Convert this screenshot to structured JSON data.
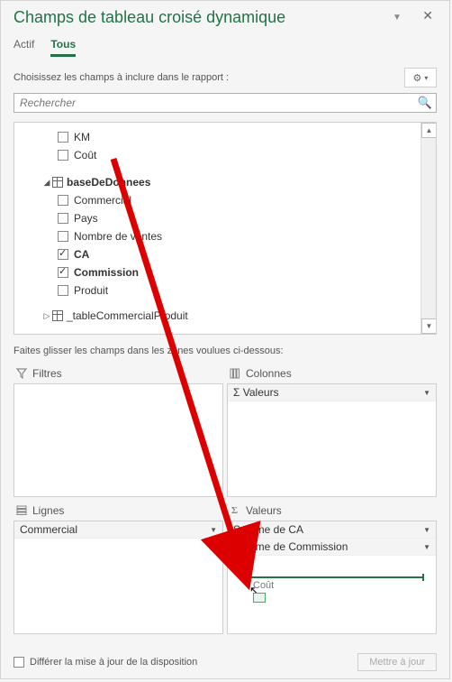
{
  "title": "Champs de tableau croisé dynamique",
  "tabs": {
    "actif": "Actif",
    "tous": "Tous"
  },
  "chooseText": "Choisissez les champs à inclure dans le rapport :",
  "search": {
    "placeholder": "Rechercher"
  },
  "tree": {
    "loose": [
      {
        "label": "KM",
        "checked": false
      },
      {
        "label": "Coût",
        "checked": false
      }
    ],
    "baseDeDonnees": {
      "name": "baseDeDonnees",
      "fields": [
        {
          "label": "Commercial",
          "checked": false,
          "bold": false
        },
        {
          "label": "Pays",
          "checked": false,
          "bold": false
        },
        {
          "label": "Nombre de ventes",
          "checked": false,
          "bold": false
        },
        {
          "label": "CA",
          "checked": true,
          "bold": true
        },
        {
          "label": "Commission",
          "checked": true,
          "bold": true
        },
        {
          "label": "Produit",
          "checked": false,
          "bold": false
        }
      ]
    },
    "tableCommercialProduit": {
      "name": "_tableCommercialProduit"
    }
  },
  "dragHint": "Faites glisser les champs dans les zones voulues ci-dessous:",
  "areas": {
    "filtres": {
      "label": "Filtres",
      "items": []
    },
    "colonnes": {
      "label": "Colonnes",
      "items": [
        "Valeurs"
      ],
      "sigma_prefix": "Σ"
    },
    "lignes": {
      "label": "Lignes",
      "items": [
        "Commercial"
      ]
    },
    "valeurs": {
      "label": "Valeurs",
      "items": [
        "Somme de CA",
        "Somme de Commission"
      ],
      "sigma": "Σ"
    }
  },
  "dragGhost": "Coût",
  "footer": {
    "defer": "Différer la mise à jour de la disposition",
    "update": "Mettre à jour"
  }
}
